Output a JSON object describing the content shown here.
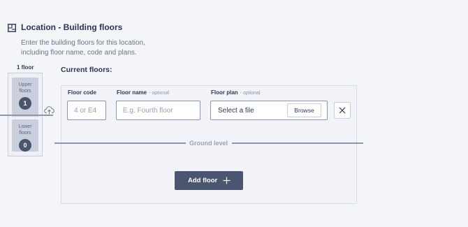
{
  "header": {
    "title": "Location - Building floors",
    "description": "Enter the building floors for this location, including floor name, code and plans.",
    "icon": "building-floors-icon"
  },
  "summary": {
    "floor_count": "1 floor",
    "upper_label": "Upper floors",
    "upper_count": "1",
    "lower_label": "Lower floors",
    "lower_count": "0"
  },
  "main": {
    "current_floors_title": "Current floors:",
    "fields": {
      "floor_code_label": "Floor code",
      "floor_code_placeholder": "4 or E4",
      "floor_name_label": "Floor name",
      "floor_name_optional": "- optional",
      "floor_name_placeholder": "E.g. Fourth floor",
      "floor_plan_label": "Floor plan",
      "floor_plan_optional": "- optional",
      "floor_plan_text": "Select a file",
      "browse_label": "Browse"
    },
    "ground_level_label": "Ground level",
    "add_floor_label": "Add floor"
  },
  "colors": {
    "accent": "#4a5670",
    "background": "#f4f5f9",
    "line": "#8d97ac"
  }
}
